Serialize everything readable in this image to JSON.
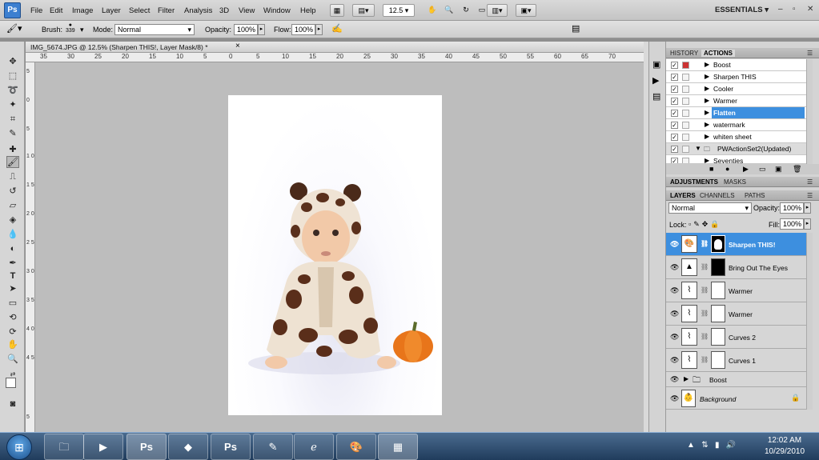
{
  "menubar": {
    "app_icon": "Ps",
    "items": [
      "File",
      "Edit",
      "Image",
      "Layer",
      "Select",
      "Filter",
      "Analysis",
      "3D",
      "View",
      "Window",
      "Help"
    ],
    "zoom": "12.5",
    "workspace": "ESSENTIALS",
    "window_controls": [
      "–",
      "▫",
      "✕"
    ]
  },
  "options": {
    "brush_label": "Brush:",
    "brush_size": "339",
    "mode_label": "Mode:",
    "mode_value": "Normal",
    "opacity_label": "Opacity:",
    "opacity_value": "100%",
    "flow_label": "Flow:",
    "flow_value": "100%"
  },
  "document": {
    "tab_title": "IMG_5674.JPG @ 12.5% (Sharpen THIS!, Layer Mask/8) *",
    "close": "×",
    "ruler_top": [
      "35",
      "30",
      "25",
      "20",
      "15",
      "10",
      "5",
      "0",
      "5",
      "10",
      "15",
      "20",
      "25",
      "30",
      "35",
      "40",
      "45",
      "50",
      "55",
      "60",
      "65",
      "70"
    ],
    "ruler_left": [
      "5",
      "0",
      "5",
      "1 0",
      "1 5",
      "2 0",
      "2 5",
      "3 0",
      "3 5",
      "4 0",
      "4 5",
      "5"
    ]
  },
  "actions_panel": {
    "tabs": [
      "HISTORY",
      "ACTIONS"
    ],
    "active_tab": "ACTIONS",
    "rows": [
      {
        "name": "Boost",
        "selected": false,
        "folder": false
      },
      {
        "name": "Sharpen THIS",
        "selected": false,
        "folder": false
      },
      {
        "name": "Cooler",
        "selected": false,
        "folder": false
      },
      {
        "name": "Warmer",
        "selected": false,
        "folder": false
      },
      {
        "name": "Flatten",
        "selected": true,
        "folder": false
      },
      {
        "name": "watermark",
        "selected": false,
        "folder": false
      },
      {
        "name": "whiten sheet",
        "selected": false,
        "folder": false
      },
      {
        "name": "PWActionSet2(Updated)",
        "selected": false,
        "folder": true
      },
      {
        "name": "Seventies",
        "selected": false,
        "folder": false
      }
    ]
  },
  "adjustments_panel": {
    "tabs": [
      "ADJUSTMENTS",
      "MASKS"
    ]
  },
  "layers_panel": {
    "tabs": [
      "LAYERS",
      "CHANNELS",
      "PATHS"
    ],
    "blend_mode": "Normal",
    "opacity_label": "Opacity:",
    "opacity_value": "100%",
    "lock_label": "Lock:",
    "fill_label": "Fill:",
    "fill_value": "100%",
    "layers": [
      {
        "name": "Sharpen THIS!",
        "selected": true,
        "mask": "white"
      },
      {
        "name": "Bring Out The Eyes",
        "selected": false,
        "mask": "black"
      },
      {
        "name": "Warmer",
        "selected": false,
        "mask": "white"
      },
      {
        "name": "Warmer",
        "selected": false,
        "mask": "white"
      },
      {
        "name": "Curves 2",
        "selected": false,
        "mask": "white"
      },
      {
        "name": "Curves 1",
        "selected": false,
        "mask": "white"
      }
    ],
    "group_name": "Boost",
    "background_name": "Background"
  },
  "taskbar": {
    "time": "12:02 AM",
    "date": "10/29/2010"
  }
}
